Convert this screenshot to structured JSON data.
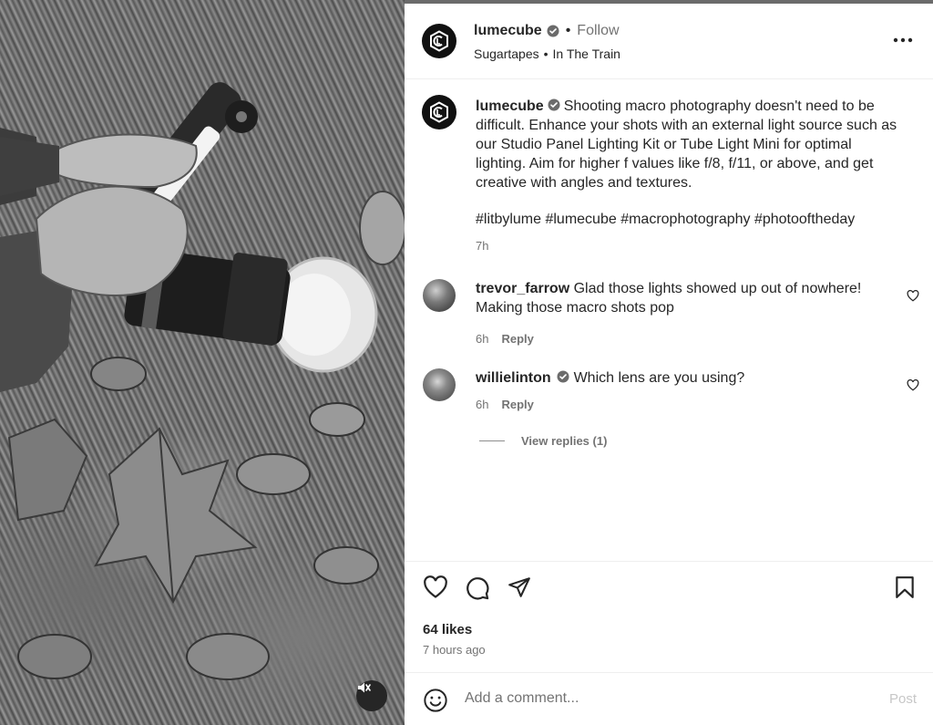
{
  "post": {
    "author": "lumecube",
    "follow_label": "Follow",
    "audio": "Sugartapes",
    "location": "In The Train",
    "dot": "•"
  },
  "caption": {
    "username": "lumecube",
    "text": "Shooting macro photography doesn't need to be difficult. Enhance your shots with an external light source such as our Studio Panel Lighting Kit or Tube Light Mini for optimal lighting. Aim for higher f values like f/8, f/11, or above, and get creative with angles and textures.",
    "hashtags": "#litbylume #lumecube #macrophotography #photooftheday",
    "time": "7h"
  },
  "comments": [
    {
      "username": "trevor_farrow",
      "text": "Glad those lights showed up out of nowhere! Making those macro shots pop",
      "time": "6h",
      "reply_label": "Reply",
      "verified": false
    },
    {
      "username": "willielinton",
      "text": "Which lens are you using?",
      "time": "6h",
      "reply_label": "Reply",
      "verified": true
    }
  ],
  "view_replies": "View replies (1)",
  "stats": {
    "likes": "64 likes",
    "posted": "7 hours ago"
  },
  "comment_box": {
    "placeholder": "Add a comment...",
    "post_label": "Post"
  },
  "icons": {
    "more": "more-options-icon",
    "like": "heart-icon",
    "comment": "comment-icon",
    "share": "share-icon",
    "save": "bookmark-icon",
    "emoji": "emoji-icon",
    "mute": "sound-off-icon",
    "verified": "verified-badge-icon"
  },
  "colors": {
    "text": "#262626",
    "muted": "#737373",
    "post_disabled": "#c7c7c7"
  }
}
